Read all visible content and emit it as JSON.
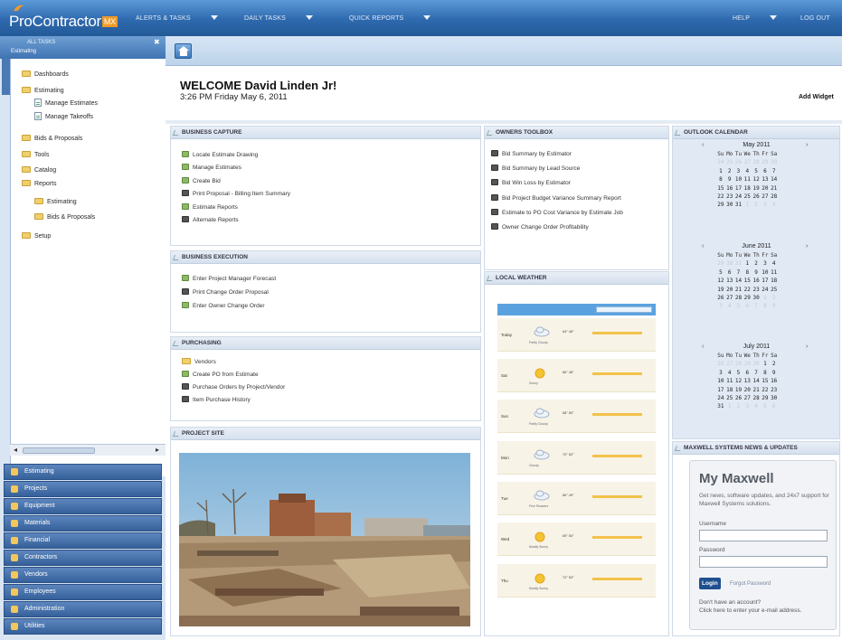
{
  "app": {
    "logo_text": "ProContractor",
    "logo_badge": "MX",
    "menus": [
      {
        "label": "Alerts & Tasks"
      },
      {
        "label": "Daily Tasks"
      },
      {
        "label": "Quick Reports"
      },
      {
        "label": "Help"
      },
      {
        "label": "Log Out"
      }
    ]
  },
  "sidebar": {
    "header_label": "All Tasks",
    "header_sub": "Estimating",
    "close_glyph": "✖",
    "tree": [
      {
        "label": "Dashboards",
        "icon": "folder-icon"
      },
      {
        "label": "Estimating",
        "icon": "folder-icon"
      },
      {
        "label": "Manage Estimates",
        "icon": "document-icon"
      },
      {
        "label": "Manage Takeoffs",
        "icon": "document-icon"
      },
      {
        "label": "Bids & Proposals",
        "icon": "folder-icon"
      },
      {
        "label": "Tools",
        "icon": "folder-icon"
      },
      {
        "label": "Catalog",
        "icon": "folder-icon"
      },
      {
        "label": "Reports",
        "icon": "folder-icon"
      },
      {
        "label": "Estimating",
        "icon": "folder-icon"
      },
      {
        "label": "Bids & Proposals",
        "icon": "folder-icon"
      },
      {
        "label": "Setup",
        "icon": "folder-icon"
      }
    ],
    "modules": [
      {
        "label": "Estimating"
      },
      {
        "label": "Projects"
      },
      {
        "label": "Equipment"
      },
      {
        "label": "Materials"
      },
      {
        "label": "Financial"
      },
      {
        "label": "Contractors"
      },
      {
        "label": "Vendors"
      },
      {
        "label": "Employees"
      },
      {
        "label": "Administration"
      },
      {
        "label": "Utilities"
      }
    ]
  },
  "welcome": {
    "title": "WELCOME David Linden Jr!",
    "datetime": "3:26 PM Friday May 6, 2011",
    "add_widget": "Add Widget"
  },
  "business_capture": {
    "title": "Business Capture",
    "items": [
      {
        "label": "Locate Estimate Drawing",
        "icon": "sheet-icon"
      },
      {
        "label": "Manage Estimates",
        "icon": "sheet-icon"
      },
      {
        "label": "Create Bid",
        "icon": "sheet-icon"
      },
      {
        "label": "Print Proposal - Billing Item Summary",
        "icon": "printer-icon"
      },
      {
        "label": "Estimate Reports",
        "icon": "sheet-icon"
      },
      {
        "label": "Alternate Reports",
        "icon": "printer-icon"
      }
    ]
  },
  "business_execution": {
    "title": "Business Execution",
    "items": [
      {
        "label": "Enter Project Manager Forecast",
        "icon": "sheet-icon"
      },
      {
        "label": "Print Change Order Proposal",
        "icon": "printer-icon"
      },
      {
        "label": "Enter Owner Change Order",
        "icon": "sheet-icon"
      }
    ]
  },
  "purchasing": {
    "title": "Purchasing",
    "items": [
      {
        "label": "Vendors",
        "icon": "folder-icon"
      },
      {
        "label": "Create PO from Estimate",
        "icon": "sheet-icon"
      },
      {
        "label": "Purchase Orders by Project/Vendor",
        "icon": "printer-icon"
      },
      {
        "label": "Item Purchase History",
        "icon": "printer-icon"
      }
    ]
  },
  "project_site": {
    "title": "Project Site"
  },
  "owners_toolbox": {
    "title": "Owners Toolbox",
    "items": [
      {
        "label": "Bid Summary by Estimator"
      },
      {
        "label": "Bid Summary by Lead Source"
      },
      {
        "label": "Bid Win Loss by Estimator"
      },
      {
        "label": "Bid Project Budget Variance Summary Report"
      },
      {
        "label": "Estimate to PO Cost Variance by Estimate Job"
      },
      {
        "label": "Owner Change Order Profitability"
      }
    ]
  },
  "local_weather": {
    "title": "Local Weather",
    "days": [
      {
        "day": "Today",
        "icon": "cloud-icon",
        "desc": "Partly Cloudy",
        "temps": "64° 46°"
      },
      {
        "day": "Sat",
        "icon": "sun-icon",
        "desc": "Sunny",
        "temps": "66° 48°"
      },
      {
        "day": "Sun",
        "icon": "cloud-icon",
        "desc": "Partly Cloudy",
        "temps": "68° 50°"
      },
      {
        "day": "Mon",
        "icon": "cloud-icon",
        "desc": "Cloudy",
        "temps": "70° 52°"
      },
      {
        "day": "Tue",
        "icon": "cloud-icon",
        "desc": "Few Showers",
        "temps": "66° 49°"
      },
      {
        "day": "Wed",
        "icon": "sun-icon",
        "desc": "Mostly Sunny",
        "temps": "69° 50°"
      },
      {
        "day": "Thu",
        "icon": "sun-icon",
        "desc": "Mostly Sunny",
        "temps": "72° 53°"
      }
    ]
  },
  "outlook_calendar": {
    "title": "Outlook Calendar",
    "weekdays": [
      "Su",
      "Mo",
      "Tu",
      "We",
      "Th",
      "Fr",
      "Sa"
    ],
    "months": [
      {
        "name": "May 2011",
        "weeks": [
          [
            "24",
            "25",
            "26",
            "27",
            "28",
            "29",
            "30"
          ],
          [
            "1",
            "2",
            "3",
            "4",
            "5",
            "6",
            "7"
          ],
          [
            "8",
            "9",
            "10",
            "11",
            "12",
            "13",
            "14"
          ],
          [
            "15",
            "16",
            "17",
            "18",
            "19",
            "20",
            "21"
          ],
          [
            "22",
            "23",
            "24",
            "25",
            "26",
            "27",
            "28"
          ],
          [
            "29",
            "30",
            "31",
            "1",
            "2",
            "3",
            "4"
          ]
        ],
        "dim": [
          [
            0,
            0
          ],
          [
            0,
            1
          ],
          [
            0,
            2
          ],
          [
            0,
            3
          ],
          [
            0,
            4
          ],
          [
            0,
            5
          ],
          [
            0,
            6
          ],
          [
            5,
            3
          ],
          [
            5,
            4
          ],
          [
            5,
            5
          ],
          [
            5,
            6
          ]
        ]
      },
      {
        "name": "June 2011",
        "weeks": [
          [
            "29",
            "30",
            "31",
            "1",
            "2",
            "3",
            "4"
          ],
          [
            "5",
            "6",
            "7",
            "8",
            "9",
            "10",
            "11"
          ],
          [
            "12",
            "13",
            "14",
            "15",
            "16",
            "17",
            "18"
          ],
          [
            "19",
            "20",
            "21",
            "22",
            "23",
            "24",
            "25"
          ],
          [
            "26",
            "27",
            "28",
            "29",
            "30",
            "1",
            "2"
          ],
          [
            "3",
            "4",
            "5",
            "6",
            "7",
            "8",
            "9"
          ]
        ],
        "dim": [
          [
            0,
            0
          ],
          [
            0,
            1
          ],
          [
            0,
            2
          ],
          [
            4,
            5
          ],
          [
            4,
            6
          ],
          [
            5,
            0
          ],
          [
            5,
            1
          ],
          [
            5,
            2
          ],
          [
            5,
            3
          ],
          [
            5,
            4
          ],
          [
            5,
            5
          ],
          [
            5,
            6
          ]
        ]
      },
      {
        "name": "July 2011",
        "weeks": [
          [
            "26",
            "27",
            "28",
            "29",
            "30",
            "1",
            "2"
          ],
          [
            "3",
            "4",
            "5",
            "6",
            "7",
            "8",
            "9"
          ],
          [
            "10",
            "11",
            "12",
            "13",
            "14",
            "15",
            "16"
          ],
          [
            "17",
            "18",
            "19",
            "20",
            "21",
            "22",
            "23"
          ],
          [
            "24",
            "25",
            "26",
            "27",
            "28",
            "29",
            "30"
          ],
          [
            "31",
            "1",
            "2",
            "3",
            "4",
            "5",
            "6"
          ]
        ],
        "dim": [
          [
            0,
            0
          ],
          [
            0,
            1
          ],
          [
            0,
            2
          ],
          [
            0,
            3
          ],
          [
            0,
            4
          ],
          [
            5,
            1
          ],
          [
            5,
            2
          ],
          [
            5,
            3
          ],
          [
            5,
            4
          ],
          [
            5,
            5
          ],
          [
            5,
            6
          ]
        ]
      }
    ]
  },
  "maxwell": {
    "title": "Maxwell Systems News & Updates",
    "box_title": "My Maxwell",
    "description": "Get news, software updates, and 24x7 support for Maxwell Systems solutions.",
    "username_label": "Username",
    "password_label": "Password",
    "login_label": "Login",
    "forgot_label": "Forgot Password",
    "no_account": "Don't have an account?",
    "register": "Click here to enter your e-mail address."
  },
  "colors": {
    "topbar": "#2e69ae",
    "sidebar": "#d9e5f2",
    "module": "#35609a",
    "panel_header": "#d5e0ee",
    "weather_bar": "#f3c24a",
    "login_button": "#1f4f8f"
  }
}
